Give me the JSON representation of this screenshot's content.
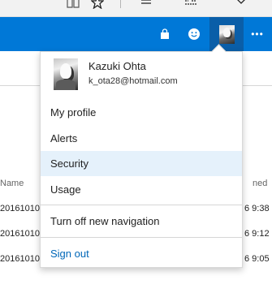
{
  "browser_toolbar": {
    "icons": [
      "reading-view-icon",
      "favorite-star-icon",
      "hub-icon",
      "web-note-icon",
      "share-icon"
    ]
  },
  "header": {
    "accent_color": "#0078d7",
    "icons": [
      "store-bag-icon",
      "smiley-feedback-icon",
      "account-avatar-icon",
      "more-options-icon"
    ],
    "more_label": "•••"
  },
  "background_list": {
    "left_column_header": "Name",
    "right_column_header": "ned",
    "left_cells": [
      "20161010",
      "20161010",
      "20161010"
    ],
    "right_cells": [
      "6 9:38",
      "6 9:12",
      "6 9:05"
    ]
  },
  "account_menu": {
    "name": "Kazuki Ohta",
    "email": "k_ota28@hotmail.com",
    "items": [
      {
        "label": "My profile"
      },
      {
        "label": "Alerts"
      },
      {
        "label": "Security"
      },
      {
        "label": "Usage"
      },
      {
        "label": "Turn off new navigation"
      },
      {
        "label": "Sign out"
      }
    ],
    "hover_color": "#e5f1fb",
    "link_color": "#0067b8"
  }
}
